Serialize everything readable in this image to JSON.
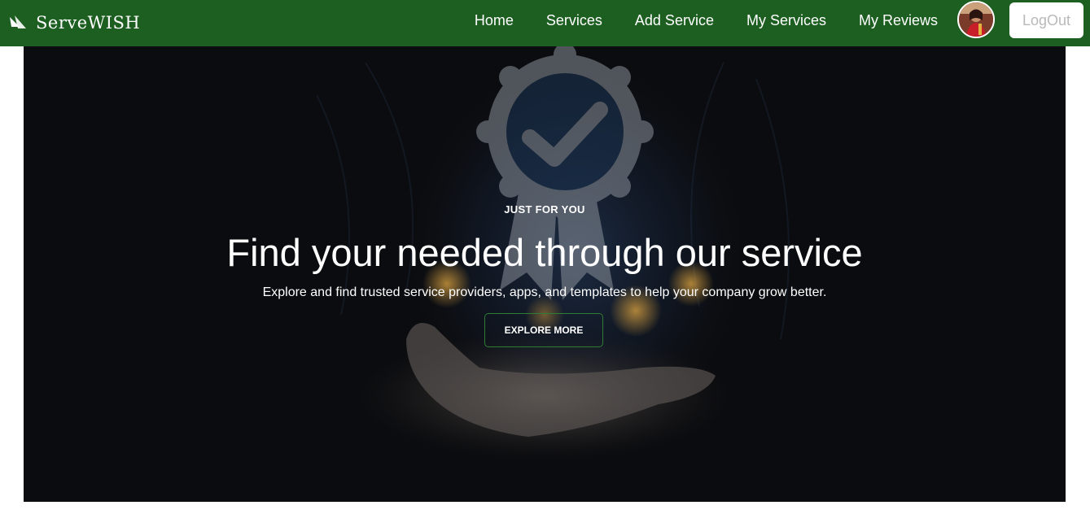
{
  "colors": {
    "navbar_bg": "#1d5e21",
    "hero_bg": "#0b0c0f",
    "accent": "#2f7d34",
    "logout_text": "#b9b9b9"
  },
  "navbar": {
    "brand": {
      "icon": "sail-logo-icon",
      "name": "ServeWISH"
    },
    "links": [
      {
        "label": "Home"
      },
      {
        "label": "Services"
      },
      {
        "label": "Add Service"
      },
      {
        "label": "My Services"
      },
      {
        "label": "My Reviews"
      }
    ],
    "avatar_icon": "user-avatar",
    "logout_label": "LogOut"
  },
  "hero": {
    "background_icon": "award-badge-hand-icon",
    "eyebrow": "JUST FOR YOU",
    "headline": "Find your needed through our service",
    "subline": "Explore and find trusted service providers, apps, and templates to help your company grow better.",
    "cta_label": "EXPLORE MORE"
  }
}
